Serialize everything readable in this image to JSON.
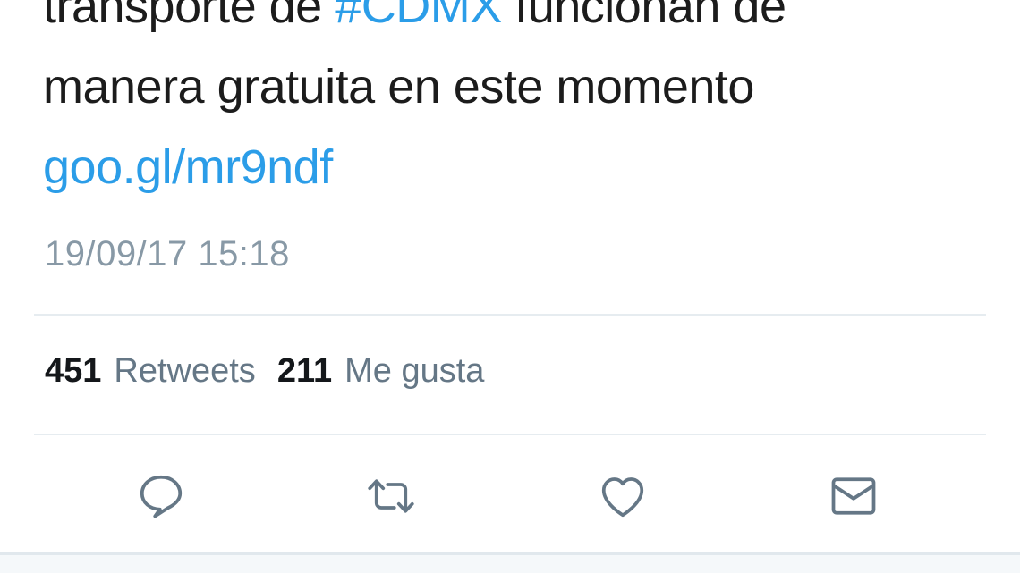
{
  "tweet": {
    "line1_before": "transporte de ",
    "line1_hashtag": "#CDMX",
    "line1_after": " funcionan de",
    "line2": "manera gratuita en este momento",
    "link": "goo.gl/mr9ndf",
    "timestamp": "19/09/17 15:18"
  },
  "stats": {
    "retweets_count": "451",
    "retweets_label": "Retweets",
    "likes_count": "211",
    "likes_label": "Me gusta"
  },
  "actions": {
    "reply_icon": "reply-icon",
    "retweet_icon": "retweet-icon",
    "like_icon": "heart-icon",
    "dm_icon": "envelope-icon"
  },
  "colors": {
    "link": "#2b9de8",
    "muted": "#8899a6",
    "icon": "#657786",
    "divider": "#e6ecf0"
  }
}
